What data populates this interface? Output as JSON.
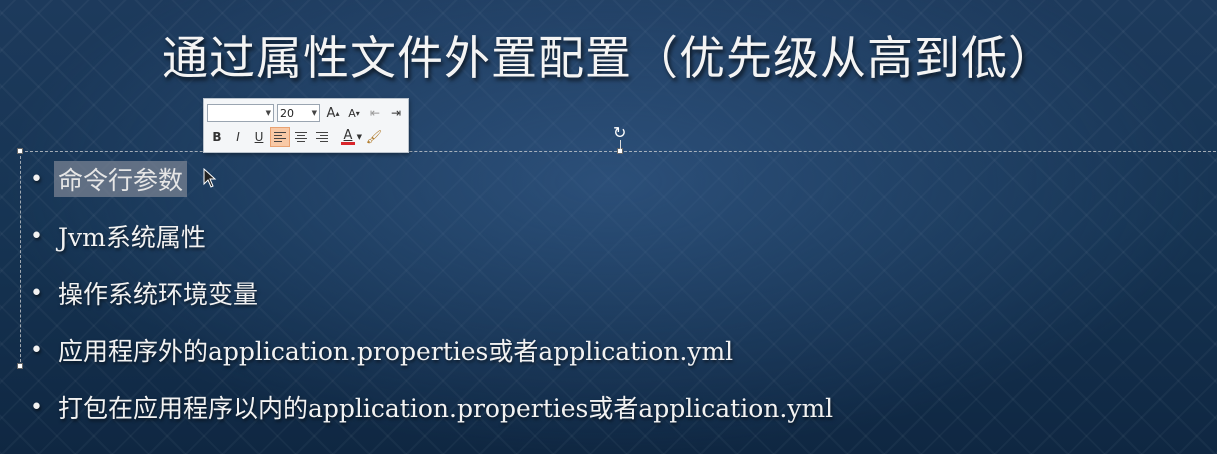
{
  "slide": {
    "title": "通过属性文件外置配置（优先级从高到低）",
    "bullets": [
      "命令行参数",
      "Jvm系统属性",
      "操作系统环境变量",
      "应用程序外的application.properties或者application.yml",
      "打包在应用程序以内的application.properties或者application.yml"
    ]
  },
  "toolbar": {
    "font_name": "",
    "font_size": "20",
    "buttons": {
      "grow_font": "A",
      "shrink_font": "A",
      "bold": "B",
      "italic": "I",
      "underline": "U",
      "font_color": "A"
    },
    "colors": {
      "font_color_bar": "#d9262c",
      "active_button": "#f8c9a6"
    }
  }
}
